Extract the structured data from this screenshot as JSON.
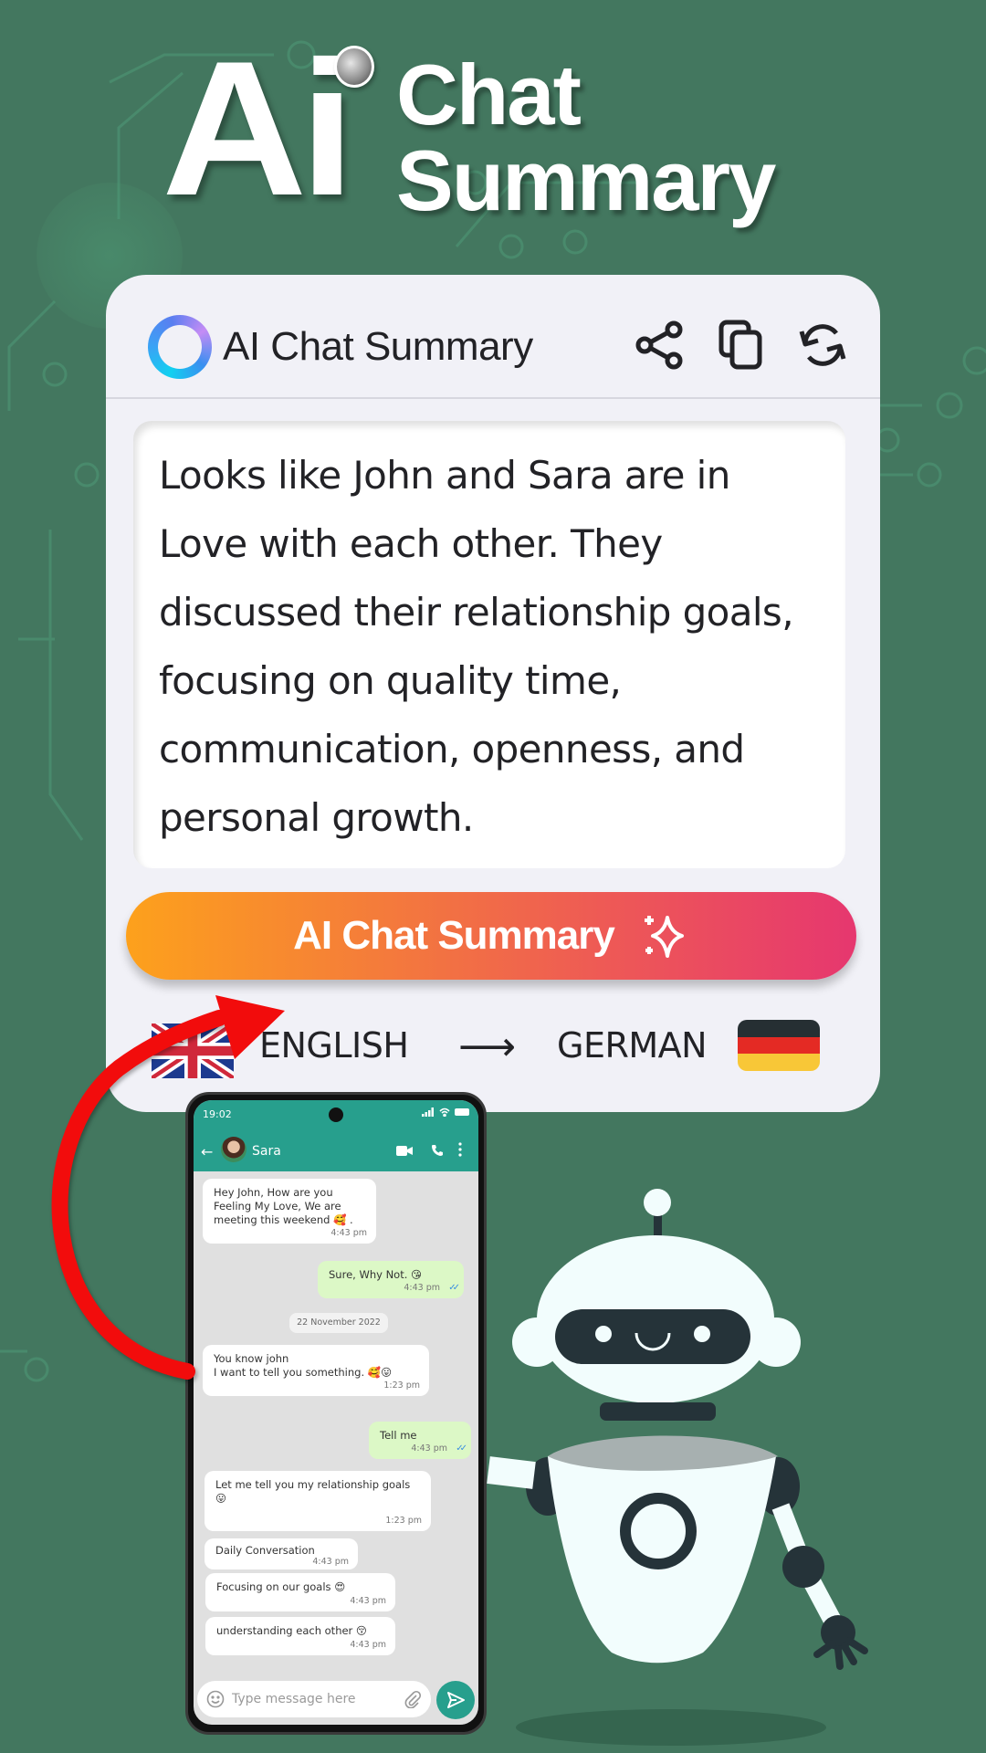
{
  "hero": {
    "ai": "Ai",
    "line1": "Chat",
    "line2": "Summary"
  },
  "card": {
    "title": "AI Chat Summary",
    "actions": {
      "share": "share-icon",
      "copy": "copy-icon",
      "refresh": "refresh-icon"
    },
    "summary": "Looks like John and Sara are in Love with each other. They discussed their relationship goals, focusing on quality time, communication, openness, and personal growth.",
    "button_label": "AI Chat Summary",
    "button_icon": "sparkle-icon",
    "button_gradient": [
      "#fda11c",
      "#e6376f"
    ],
    "source_language": "ENGLISH",
    "target_language": "GERMAN",
    "arrow": "⟶"
  },
  "phone": {
    "status_time": "19:02",
    "contact_name": "Sara",
    "back": "←",
    "brand_color": "#279f8d",
    "date_chip": "22 November 2022",
    "messages": [
      {
        "dir": "in",
        "text": "Hey John, How are you Feeling My Love, We are meeting this weekend 🥰 .",
        "time": "4:43 pm"
      },
      {
        "dir": "out",
        "text": "Sure, Why Not. 😘",
        "time": "4:43 pm",
        "ticks": "✓✓"
      },
      {
        "dir": "in",
        "text": "You know john\nI want to tell you something. 🥰😛",
        "time": "1:23 pm"
      },
      {
        "dir": "out",
        "text": "Tell me",
        "time": "4:43 pm",
        "ticks": "✓✓"
      },
      {
        "dir": "in",
        "text": "Let me tell you my relationship goals  😛",
        "time": "1:23 pm"
      },
      {
        "dir": "in",
        "text": "Daily Conversation",
        "time": "4:43 pm"
      },
      {
        "dir": "in",
        "text": "Focusing on our goals 😍",
        "time": "4:43 pm"
      },
      {
        "dir": "in",
        "text": "understanding each other  😚",
        "time": "4:43 pm"
      }
    ],
    "input_placeholder": "Type message here"
  },
  "colors": {
    "background": "#43775f",
    "card": "#f1f1f7",
    "arrow_red": "#f00f0f"
  }
}
